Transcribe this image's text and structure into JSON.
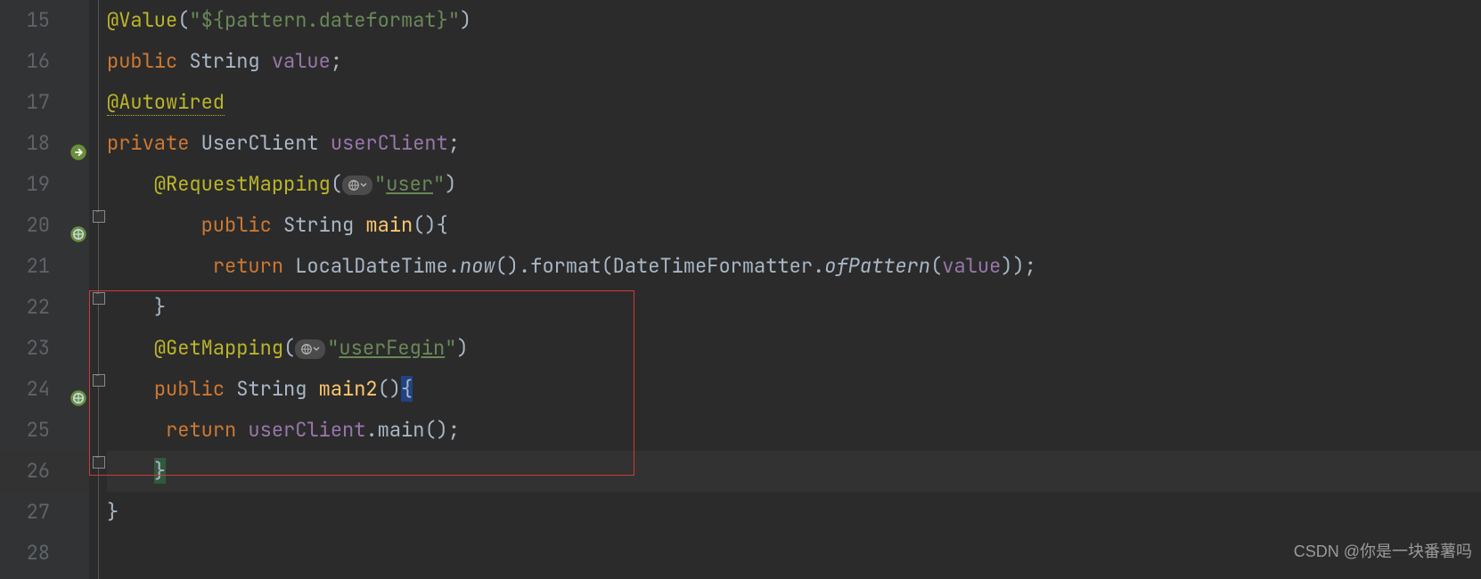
{
  "lines": {
    "n15": "15",
    "n16": "16",
    "n17": "17",
    "n18": "18",
    "n19": "19",
    "n20": "20",
    "n21": "21",
    "n22": "22",
    "n23": "23",
    "n24": "24",
    "n25": "25",
    "n26": "26",
    "n27": "27",
    "n28": "28"
  },
  "code": {
    "l15_ann": "@Value",
    "l15_str": "${pattern.dateformat}",
    "l16_kw": "public",
    "l16_type": "String",
    "l16_field": "value",
    "l17_ann": "@Autowired",
    "l18_kw": "private",
    "l18_type": "UserClient",
    "l18_field": "userClient",
    "l19_ann": "@RequestMapping",
    "l19_str": "user",
    "l20_kw": "public",
    "l20_type": "String",
    "l20_m": "main",
    "l21_kw": "return",
    "l21_t1": "LocalDateTime",
    "l21_m1": "now",
    "l21_m2": "format",
    "l21_t2": "DateTimeFormatter",
    "l21_m3": "ofPattern",
    "l21_f": "value",
    "l23_ann": "@GetMapping",
    "l23_str": "userFegin",
    "l24_kw": "public",
    "l24_type": "String",
    "l24_m": "main2",
    "l25_kw": "return",
    "l25_f": "userClient",
    "l25_m": "main"
  },
  "watermark": "CSDN @你是一块番薯吗"
}
